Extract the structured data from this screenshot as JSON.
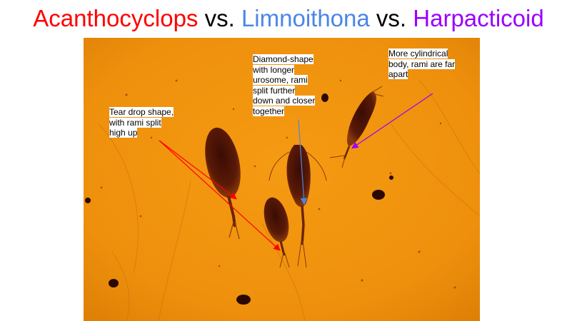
{
  "title": {
    "part1": "Acanthocyclops",
    "sep1": " vs. ",
    "part2": "Limnoithona",
    "sep2": " vs. ",
    "part3": "Harpacticoid"
  },
  "annotations": {
    "acanthocyclops": [
      "Tear drop shape,",
      "with rami split",
      "high up"
    ],
    "limnoithona": [
      "Diamond-shape",
      "with longer",
      "urosome, rami",
      "split further",
      "down and closer",
      "together"
    ],
    "harpacticoid": [
      "More cylindrical",
      "body, rami are far",
      "apart"
    ]
  },
  "colors": {
    "acanthocyclops": "#ff0000",
    "limnoithona": "#4a86e8",
    "harpacticoid": "#9900ff",
    "background": "#f0900e"
  }
}
